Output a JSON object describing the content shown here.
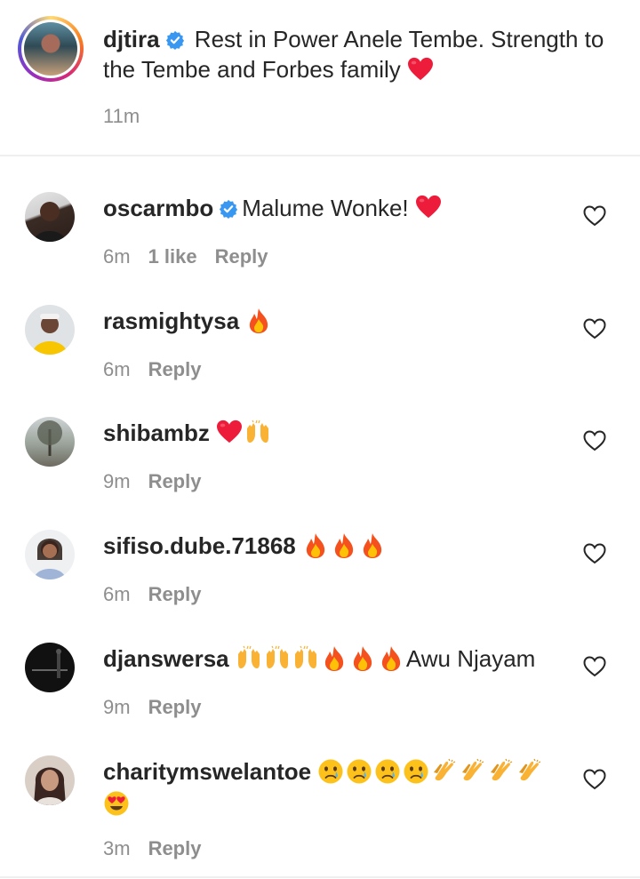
{
  "post": {
    "username": "djtira",
    "text": " Rest in Power Anele Tembe. Strength to the Tembe and Forbes family ",
    "time": "11m"
  },
  "comments": [
    {
      "username": "oscarmbo",
      "verified": true,
      "text": "Malume Wonke! ",
      "time": "6m",
      "likes": "1 like",
      "reply": "Reply"
    },
    {
      "username": "rasmightysa",
      "verified": false,
      "text": "",
      "time": "6m",
      "reply": "Reply"
    },
    {
      "username": "shibambz",
      "verified": false,
      "text": "",
      "time": "9m",
      "reply": "Reply"
    },
    {
      "username": "sifiso.dube.71868",
      "verified": false,
      "text": "",
      "time": "6m",
      "reply": "Reply"
    },
    {
      "username": "djanswersa",
      "verified": false,
      "text": "Awu Njayam",
      "time": "9m",
      "reply": "Reply"
    },
    {
      "username": "charitymswelantoe",
      "verified": false,
      "text": "",
      "time": "3m",
      "reply": "Reply"
    }
  ],
  "colors": {
    "text": "#262626",
    "muted": "#8e8e8e",
    "verified": "#3897f0",
    "heart": "#ed1c3b"
  },
  "icons": {
    "verified": "verified-badge-icon",
    "like": "heart-outline-icon",
    "fire": "fire-emoji",
    "red_heart": "red-heart-emoji",
    "raised_hands": "raised-hands-emoji",
    "clap": "clapping-hands-emoji",
    "cry": "crying-face-emoji",
    "heart_eyes": "heart-eyes-emoji"
  }
}
